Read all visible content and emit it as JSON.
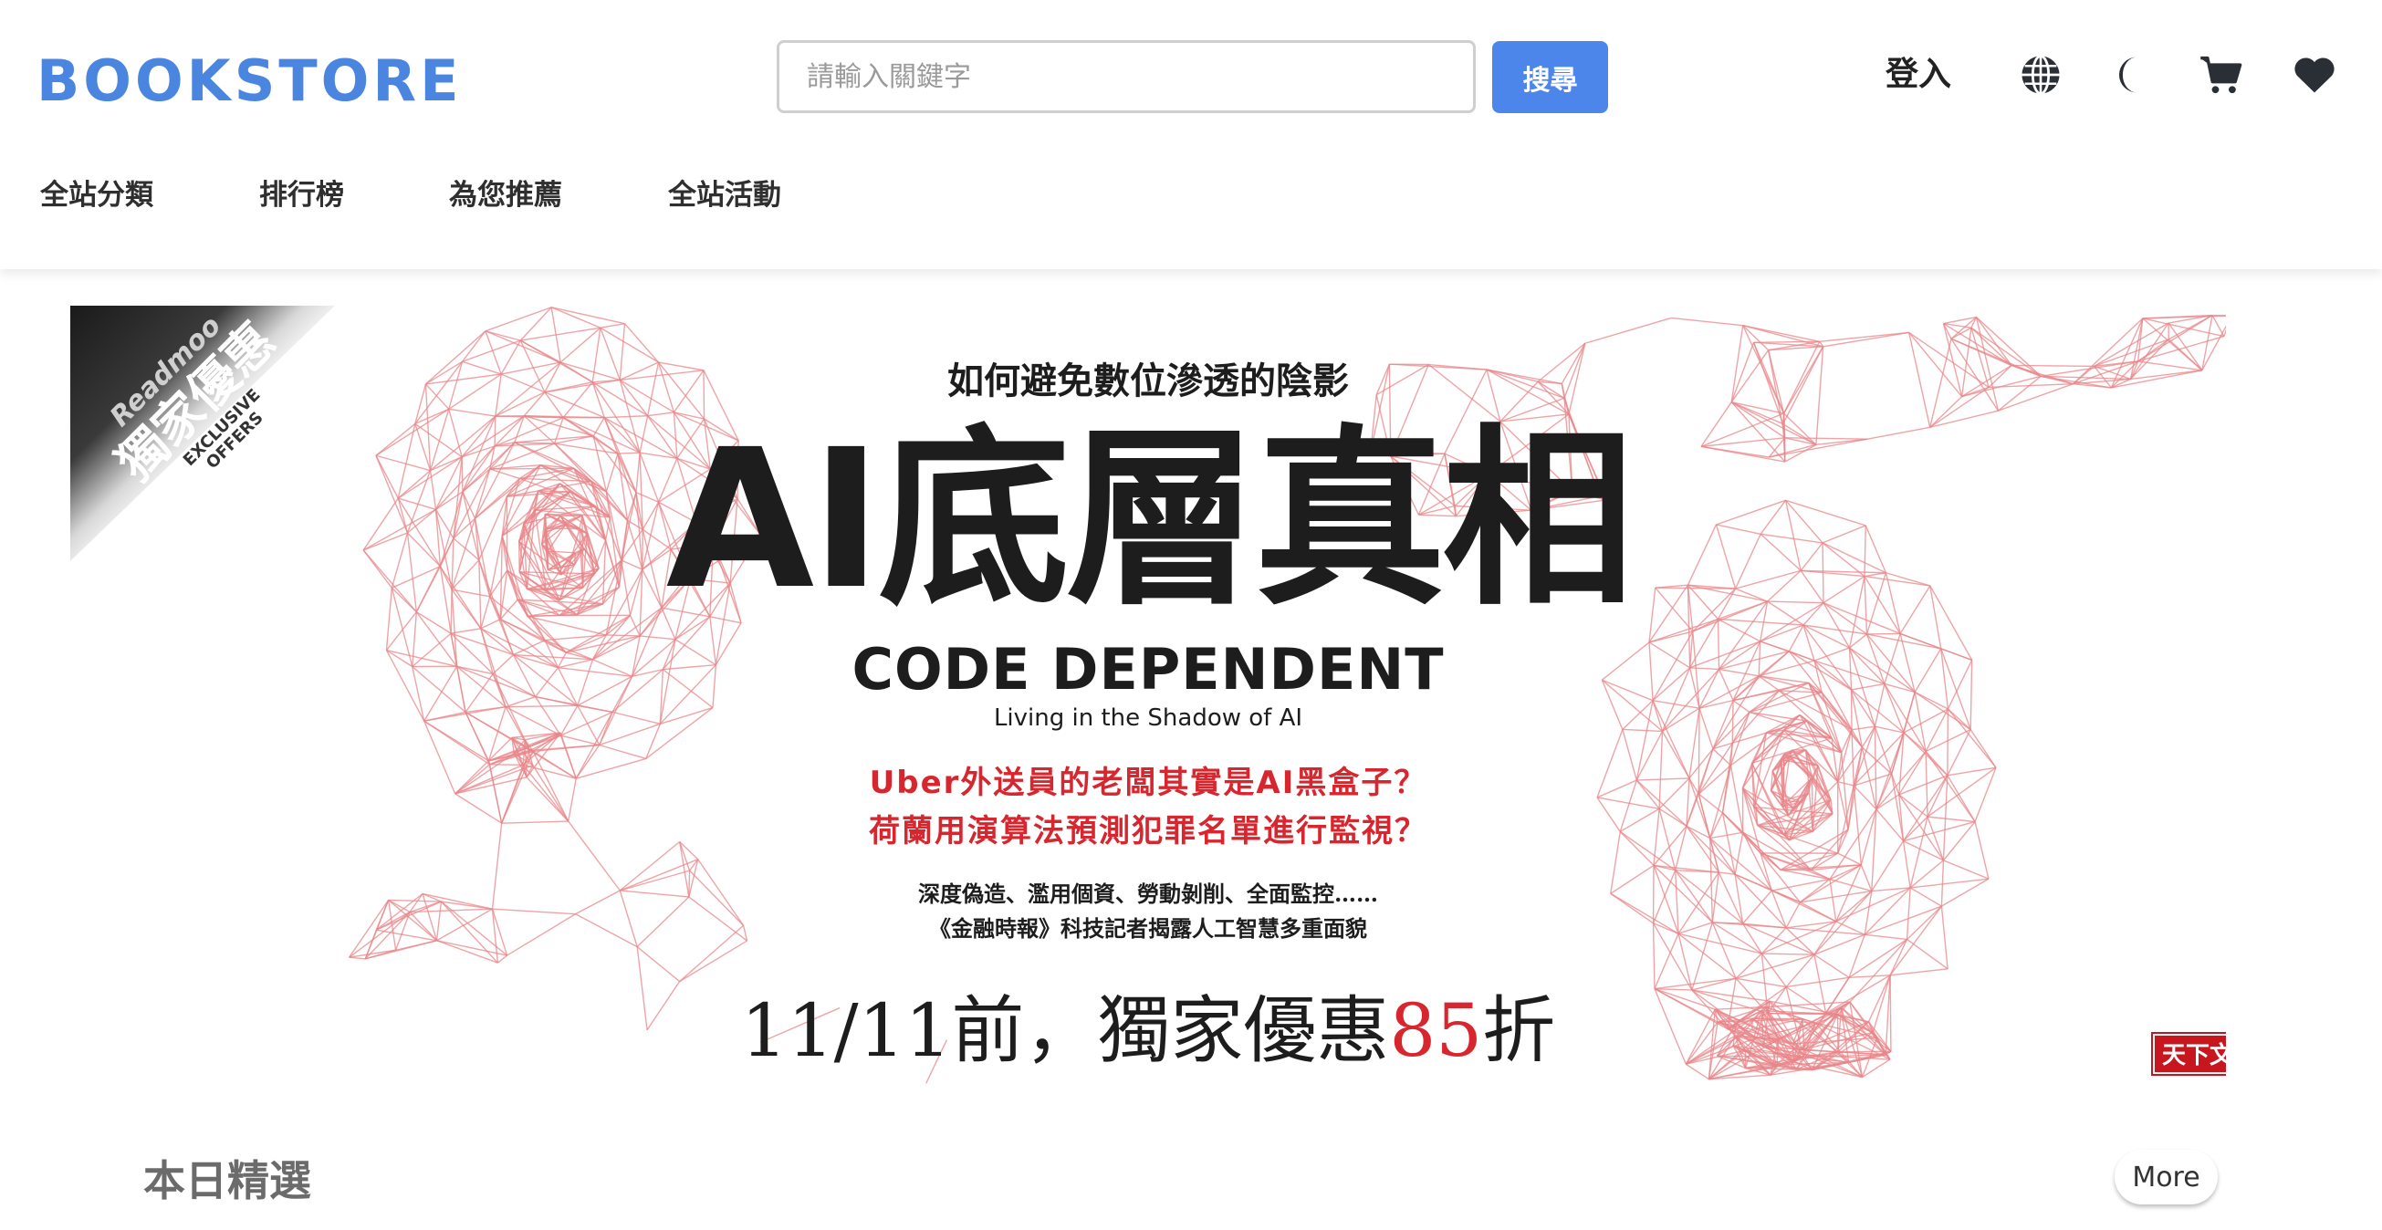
{
  "header": {
    "logo": "BOOKSTORE",
    "search": {
      "placeholder": "請輸入關鍵字",
      "value": ""
    },
    "search_button": "搜尋",
    "login": "登入",
    "icons": [
      "globe-icon",
      "moon-icon",
      "cart-icon",
      "heart-icon"
    ]
  },
  "nav": {
    "items": [
      {
        "label": "全站分類"
      },
      {
        "label": "排行榜"
      },
      {
        "label": "為您推薦"
      },
      {
        "label": "全站活動"
      }
    ]
  },
  "banner": {
    "ribbon": {
      "brand": "Readmoo",
      "main": "獨家優惠",
      "sub1": "EXCLUSIVE",
      "sub2": "OFFERS"
    },
    "kicker": "如何避免數位滲透的陰影",
    "title": "AI底層真相",
    "en_title": "CODE DEPENDENT",
    "en_subtitle": "Living in the Shadow of AI",
    "question1": "Uber外送員的老闆其實是AI黑盒子？",
    "question2": "荷蘭用演算法預測犯罪名單進行監視？",
    "note1": "深度偽造、濫用個資、勞動剝削、全面監控……",
    "note2": "《金融時報》科技記者揭露人工智慧多重面貌",
    "promo_prefix": "11/11前，獨家優惠",
    "promo_accent": "85",
    "promo_suffix": "折",
    "publisher": "天下文化"
  },
  "section": {
    "title": "本日精選",
    "more": "More"
  },
  "colors": {
    "brand": "#4a86e0",
    "search_button": "#4d86ea",
    "accent_red": "#d8262e",
    "mesh": "#e8868a"
  }
}
